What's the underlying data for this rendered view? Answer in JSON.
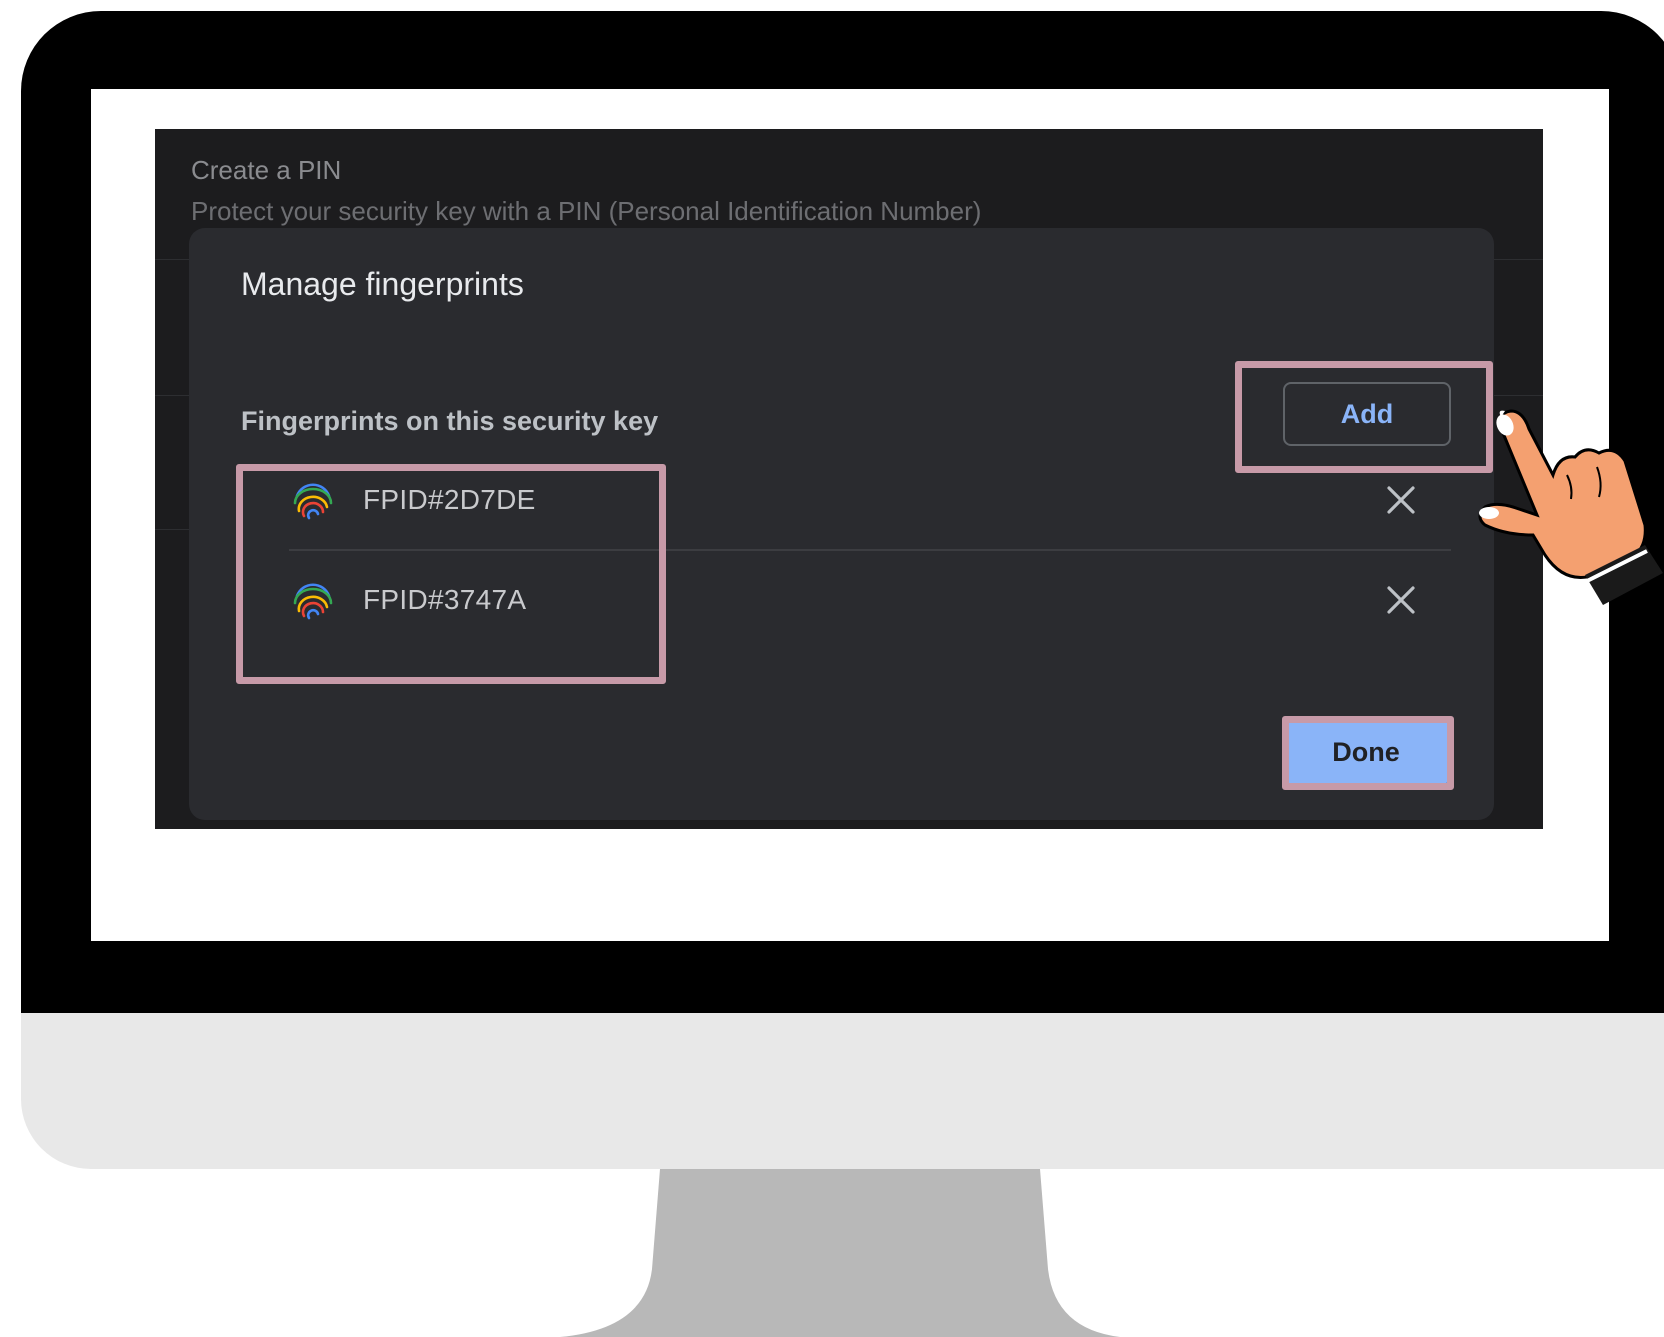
{
  "background_panel": {
    "title": "Create a PIN",
    "description": "Protect your security key with a PIN (Personal Identification Number)"
  },
  "dialog": {
    "title": "Manage fingerprints",
    "section_label": "Fingerprints on this security key",
    "add_label": "Add",
    "done_label": "Done",
    "fingerprints": [
      {
        "name": "FPID#2D7DE",
        "icon": "fingerprint-icon"
      },
      {
        "name": "FPID#3747A",
        "icon": "fingerprint-icon"
      }
    ]
  },
  "colors": {
    "accent": "#8ab4f8",
    "dialog_bg": "#2a2b2f",
    "highlight": "#c79aa8",
    "hand_skin": "#f4a070"
  }
}
